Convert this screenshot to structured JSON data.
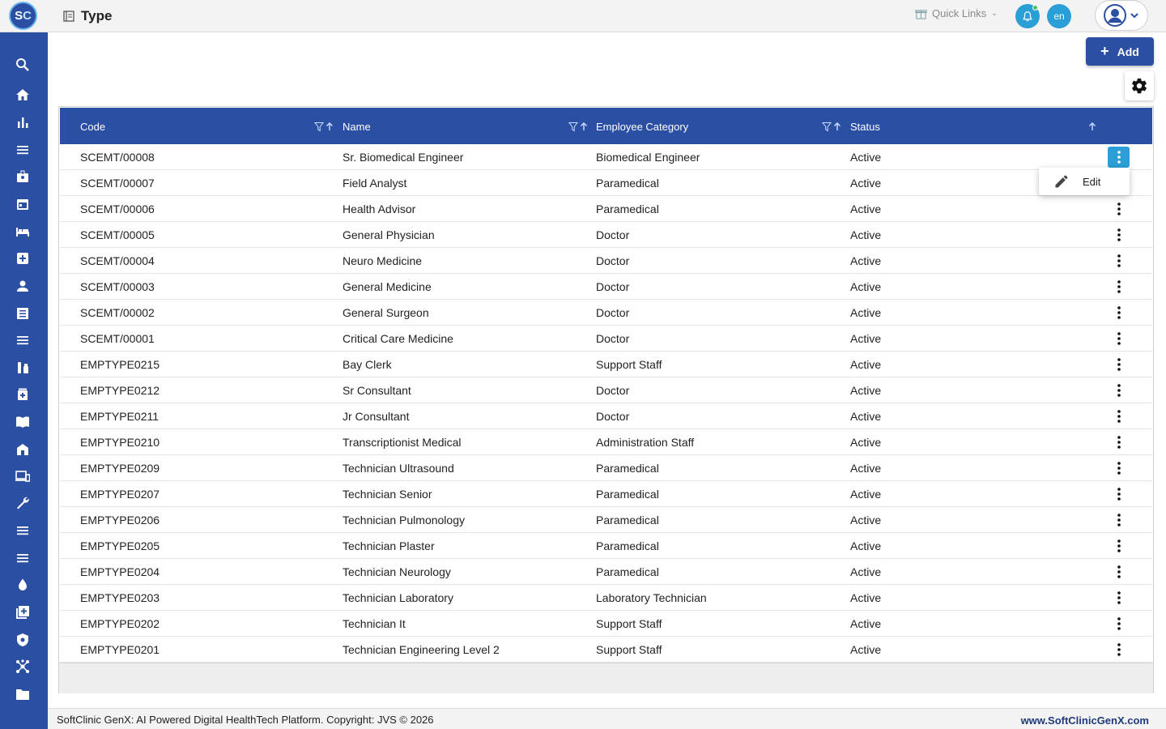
{
  "app": {
    "logo_text_s": "S",
    "logo_text_c": "C",
    "page_title": "Type"
  },
  "topbar": {
    "quick_links": "Quick Links",
    "lang": "en"
  },
  "sidebar": {
    "items": [
      "search-icon",
      "home-icon",
      "bar-chart-icon",
      "menu-icon",
      "badge-icon",
      "calendar-icon",
      "bed-icon",
      "medical-kit-icon",
      "person-icon",
      "receipt-icon",
      "list-icon",
      "lab-icon",
      "pharmacy-icon",
      "book-icon",
      "building-icon",
      "devices-icon",
      "wrench-icon",
      "menu-icon",
      "menu-icon",
      "blood-drop-icon",
      "add-box-icon",
      "shield-icon",
      "hub-icon",
      "folder-icon"
    ]
  },
  "actions": {
    "add_label": "Add"
  },
  "table": {
    "headers": {
      "code": "Code",
      "name": "Name",
      "category": "Employee Category",
      "status": "Status"
    },
    "rows": [
      {
        "code": "SCEMT/00008",
        "name": "Sr. Biomedical Engineer",
        "category": "Biomedical Engineer",
        "status": "Active"
      },
      {
        "code": "SCEMT/00007",
        "name": "Field Analyst",
        "category": "Paramedical",
        "status": "Active"
      },
      {
        "code": "SCEMT/00006",
        "name": "Health Advisor",
        "category": "Paramedical",
        "status": "Active"
      },
      {
        "code": "SCEMT/00005",
        "name": "General Physician",
        "category": "Doctor",
        "status": "Active"
      },
      {
        "code": "SCEMT/00004",
        "name": "Neuro Medicine",
        "category": "Doctor",
        "status": "Active"
      },
      {
        "code": "SCEMT/00003",
        "name": "General Medicine",
        "category": "Doctor",
        "status": "Active"
      },
      {
        "code": "SCEMT/00002",
        "name": "General Surgeon",
        "category": "Doctor",
        "status": "Active"
      },
      {
        "code": "SCEMT/00001",
        "name": "Critical Care Medicine",
        "category": "Doctor",
        "status": "Active"
      },
      {
        "code": "EMPTYPE0215",
        "name": "Bay Clerk",
        "category": "Support Staff",
        "status": "Active"
      },
      {
        "code": "EMPTYPE0212",
        "name": "Sr Consultant",
        "category": "Doctor",
        "status": "Active"
      },
      {
        "code": "EMPTYPE0211",
        "name": "Jr Consultant",
        "category": "Doctor",
        "status": "Active"
      },
      {
        "code": "EMPTYPE0210",
        "name": "Transcriptionist Medical",
        "category": "Administration Staff",
        "status": "Active"
      },
      {
        "code": "EMPTYPE0209",
        "name": "Technician Ultrasound",
        "category": "Paramedical",
        "status": "Active"
      },
      {
        "code": "EMPTYPE0207",
        "name": "Technician Senior",
        "category": "Paramedical",
        "status": "Active"
      },
      {
        "code": "EMPTYPE0206",
        "name": "Technician Pulmonology",
        "category": "Paramedical",
        "status": "Active"
      },
      {
        "code": "EMPTYPE0205",
        "name": "Technician Plaster",
        "category": "Paramedical",
        "status": "Active"
      },
      {
        "code": "EMPTYPE0204",
        "name": "Technician Neurology",
        "category": "Paramedical",
        "status": "Active"
      },
      {
        "code": "EMPTYPE0203",
        "name": "Technician Laboratory",
        "category": "Laboratory Technician",
        "status": "Active"
      },
      {
        "code": "EMPTYPE0202",
        "name": "Technician It",
        "category": "Support Staff",
        "status": "Active"
      },
      {
        "code": "EMPTYPE0201",
        "name": "Technician Engineering Level 2",
        "category": "Support Staff",
        "status": "Active"
      }
    ]
  },
  "popup": {
    "edit_label": "Edit"
  },
  "footer": {
    "copyright": "SoftClinic GenX: AI Powered Digital HealthTech Platform. Copyright: JVS © 2026",
    "website": "www.SoftClinicGenX.com"
  },
  "colors": {
    "primary": "#2b4fa3",
    "accent": "#2a9fd6"
  }
}
